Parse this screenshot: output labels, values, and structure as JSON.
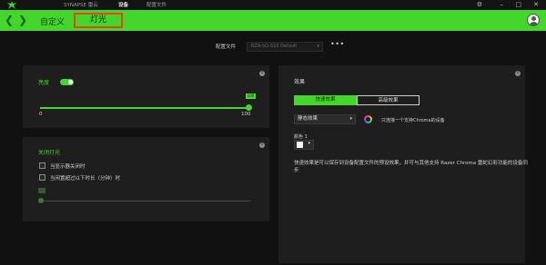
{
  "titlebar": {
    "nav": [
      "SYNAPSE 雷云",
      "设备",
      "配置文件"
    ],
    "active_nav": "设备"
  },
  "header": {
    "back_icon": "chevron-left-icon",
    "forward_icon": "chevron-right-icon",
    "tab_custom": "自定义",
    "tab_lighting": "灯光",
    "accent_color": "#44d62c",
    "highlight_color": "#e8431a"
  },
  "profile": {
    "label": "配置文件",
    "value": "RZ9-SO-S10 Default",
    "more": "•••"
  },
  "brightness": {
    "title": "亮度",
    "enabled": true,
    "value": "100",
    "level": 1.0,
    "min_label": "0",
    "max_label": "100"
  },
  "lights_off": {
    "title": "关闭灯光",
    "option_display_off": "当显示器关闭时",
    "option_idle": "当闲置超过以下时长（分钟）时",
    "option_display_off_checked": false,
    "option_idle_checked": false
  },
  "effects": {
    "title": "效果",
    "quick_tab": "快速效果",
    "advanced_tab": "高级效果",
    "effect_selected": "静态效果",
    "chroma_note": "只连接一个支持Chroma的设备",
    "color_label": "颜色 1",
    "color_value": "#ffffff",
    "description": "快速效果是可以保存到设备配置文件的预设效果，并可与其他支持 Razer Chroma 雷蛇幻彩功能的设备同步"
  }
}
